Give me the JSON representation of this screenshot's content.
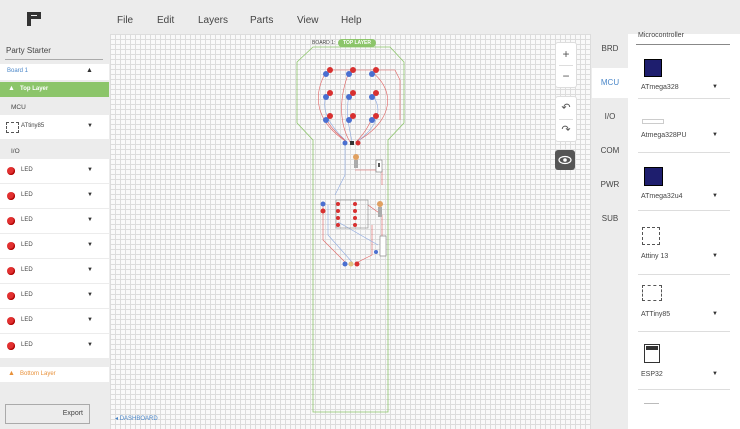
{
  "menu": [
    "File",
    "Edit",
    "Layers",
    "Parts",
    "View",
    "Help"
  ],
  "project": {
    "name": "Party Starter"
  },
  "sidebar": {
    "board": "Board 1",
    "top_layer": "Top Layer",
    "mcu_section": "MCU",
    "mcu_part": "ATtiny85",
    "io_section": "I/O",
    "io_parts": [
      "LED",
      "LED",
      "LED",
      "LED",
      "LED",
      "LED",
      "LED",
      "LED"
    ],
    "bottom_layer": "Bottom Layer",
    "export": "Export"
  },
  "canvas": {
    "board_label": "BOARD 1:",
    "layer_pill": "TOP LAYER",
    "dashboard_link": "DASHBOARD"
  },
  "tools": {
    "zoom_in": "+",
    "zoom_out": "−",
    "undo": "↶",
    "redo": "↷"
  },
  "tabs": [
    {
      "label": "BRD",
      "active": false
    },
    {
      "label": "MCU",
      "active": true
    },
    {
      "label": "I/O",
      "active": false
    },
    {
      "label": "COM",
      "active": false
    },
    {
      "label": "PWR",
      "active": false
    },
    {
      "label": "SUB",
      "active": false
    }
  ],
  "components": {
    "title": "Microcontroller",
    "items": [
      "ATmega328",
      "Atmega328PU",
      "ATmega32u4",
      "Attiny 13",
      "ATTiny85",
      "ESP32"
    ]
  },
  "colors": {
    "accent": "#4a86c8",
    "layer_green": "#8cc56a",
    "led_red": "#e23030",
    "bottom_orange": "#e8913a"
  }
}
